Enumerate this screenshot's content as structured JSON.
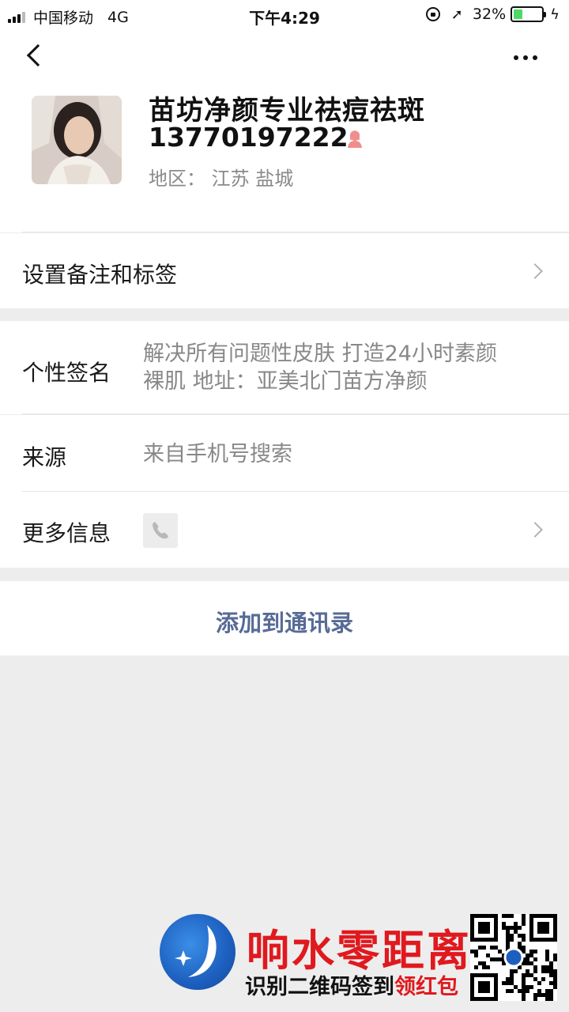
{
  "status_bar": {
    "carrier": "中国移动",
    "network": "4G",
    "time": "下午4:29",
    "battery_percent_text": "32%",
    "battery_level": 0.32
  },
  "profile": {
    "name": "苗坊净颜专业祛痘祛斑",
    "phone": "13770197222",
    "region": "地区：  江苏  盐城",
    "gender_icon": "female-icon"
  },
  "rows": {
    "remark_label": "设置备注和标签",
    "signature_label": "个性签名",
    "signature_line1": "解决所有问题性皮肤 打造24小时素颜",
    "signature_line2": "裸肌 地址：亚美北门苗方净颜",
    "source_label": "来源",
    "source_value": "来自手机号搜索",
    "more_info_label": "更多信息"
  },
  "actions": {
    "add_to_contacts": "添加到通讯录"
  },
  "watermark": {
    "title": "响水零距离",
    "subtitle_black": "识别二维码签到",
    "subtitle_red": "领红包"
  },
  "colors": {
    "link_blue": "#576b95",
    "background": "#ededed",
    "female_icon": "#f08e8e",
    "brand_red": "#e0191e"
  }
}
